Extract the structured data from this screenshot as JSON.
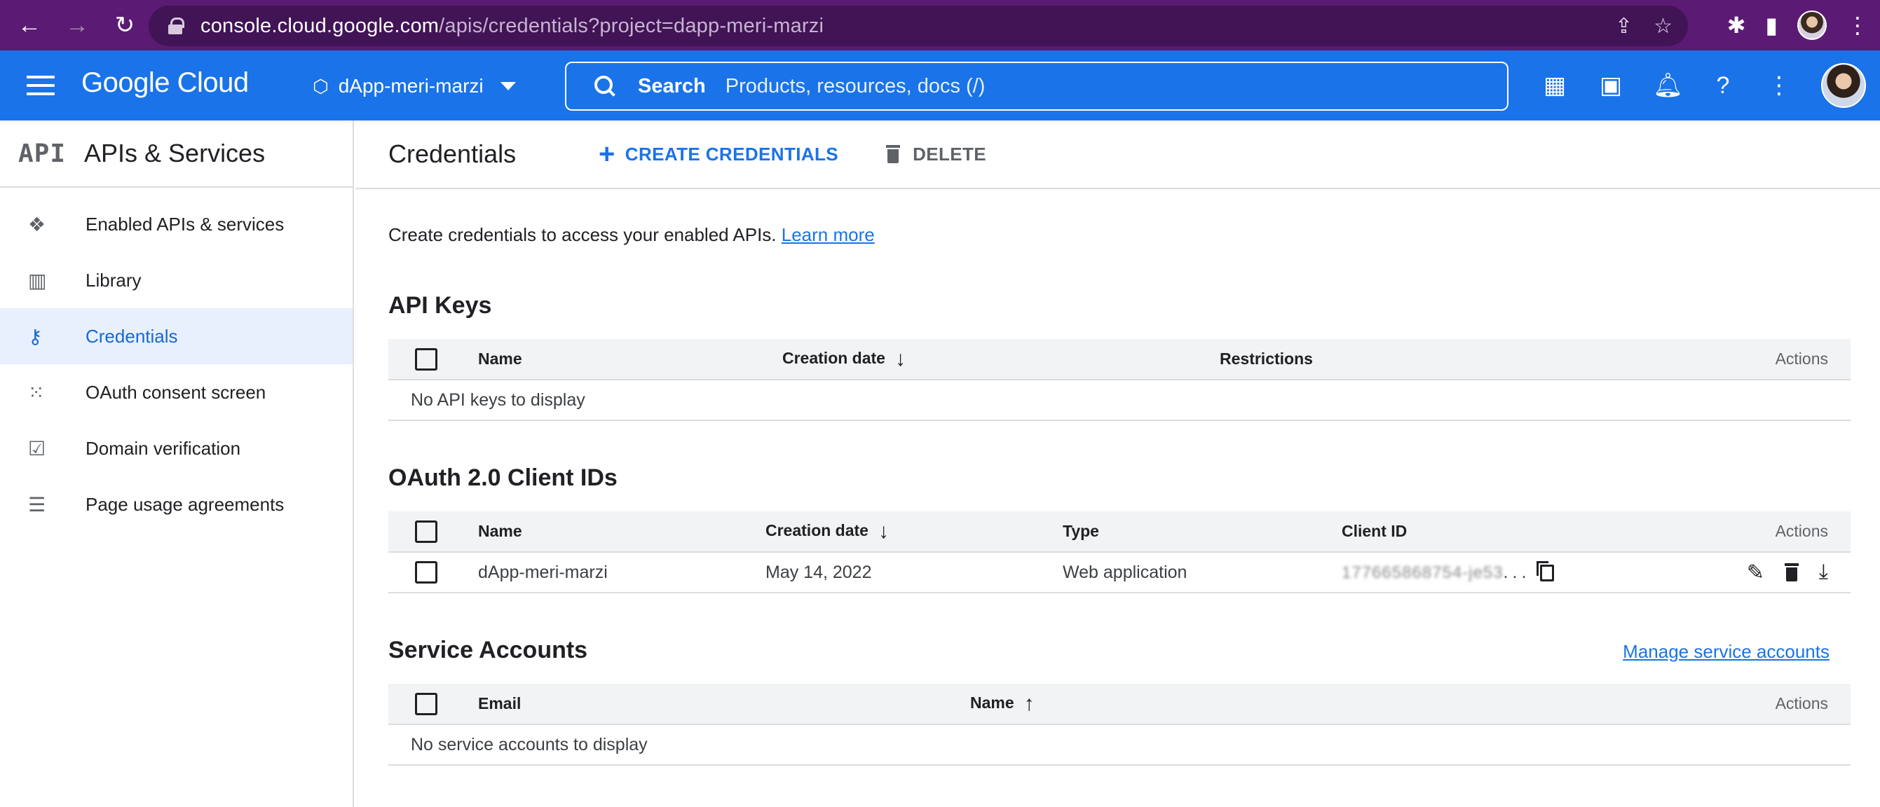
{
  "browser": {
    "url_host": "console.cloud.google.com",
    "url_path": "/apis/credentials?project=dapp-meri-marzi"
  },
  "header": {
    "logo": "Google Cloud",
    "project": "dApp-meri-marzi",
    "search_label": "Search",
    "search_placeholder": "Products, resources, docs (/)"
  },
  "sidebar": {
    "section_icon": "API",
    "title": "APIs & Services",
    "items": [
      {
        "label": "Enabled APIs & services",
        "icon": "diamond-icon"
      },
      {
        "label": "Library",
        "icon": "library-icon"
      },
      {
        "label": "Credentials",
        "icon": "key-icon",
        "active": true
      },
      {
        "label": "OAuth consent screen",
        "icon": "dots-icon"
      },
      {
        "label": "Domain verification",
        "icon": "checkbox-icon"
      },
      {
        "label": "Page usage agreements",
        "icon": "settings-list-icon"
      }
    ]
  },
  "toolbar": {
    "title": "Credentials",
    "create_label": "CREATE CREDENTIALS",
    "delete_label": "DELETE"
  },
  "intro": {
    "text": "Create credentials to access your enabled APIs.",
    "link": "Learn more"
  },
  "api_keys": {
    "title": "API Keys",
    "columns": [
      "Name",
      "Creation date",
      "Restrictions",
      "Actions"
    ],
    "empty": "No API keys to display"
  },
  "oauth": {
    "title": "OAuth 2.0 Client IDs",
    "columns": [
      "Name",
      "Creation date",
      "Type",
      "Client ID",
      "Actions"
    ],
    "rows": [
      {
        "name": "dApp-meri-marzi",
        "date": "May 14, 2022",
        "type": "Web application",
        "client_id": "177665868754-je53",
        "ellipsis": "..."
      }
    ]
  },
  "service_accounts": {
    "title": "Service Accounts",
    "manage_link": "Manage service accounts",
    "columns": [
      "Email",
      "Name",
      "Actions"
    ],
    "empty": "No service accounts to display"
  },
  "colors": {
    "chrome": "#5b1a73",
    "brand_blue": "#1a73e8",
    "active_bg": "#e8f0fe"
  }
}
